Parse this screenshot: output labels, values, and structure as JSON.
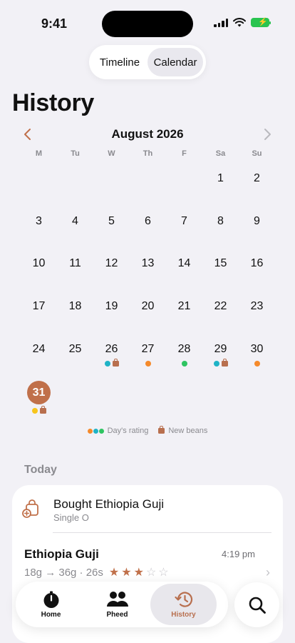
{
  "status": {
    "time": "9:41"
  },
  "segmented": {
    "options": [
      "Timeline",
      "Calendar"
    ],
    "selected": "Calendar"
  },
  "page": {
    "title": "History"
  },
  "calendar": {
    "month": "August 2026",
    "weekdays": [
      "M",
      "Tu",
      "W",
      "Th",
      "F",
      "Sa",
      "Su"
    ],
    "lead_blanks": 5,
    "days": [
      {
        "n": "1"
      },
      {
        "n": "2"
      },
      {
        "n": "3"
      },
      {
        "n": "4"
      },
      {
        "n": "5"
      },
      {
        "n": "6"
      },
      {
        "n": "7"
      },
      {
        "n": "8"
      },
      {
        "n": "9"
      },
      {
        "n": "10"
      },
      {
        "n": "11"
      },
      {
        "n": "12"
      },
      {
        "n": "13"
      },
      {
        "n": "14"
      },
      {
        "n": "15"
      },
      {
        "n": "16"
      },
      {
        "n": "17"
      },
      {
        "n": "18"
      },
      {
        "n": "19"
      },
      {
        "n": "20"
      },
      {
        "n": "21"
      },
      {
        "n": "22"
      },
      {
        "n": "23"
      },
      {
        "n": "24"
      },
      {
        "n": "25"
      },
      {
        "n": "26",
        "dots": [
          "#1fb3c6"
        ],
        "bag": true
      },
      {
        "n": "27",
        "dots": [
          "#f58a2b"
        ]
      },
      {
        "n": "28",
        "dots": [
          "#2ec461"
        ]
      },
      {
        "n": "29",
        "dots": [
          "#1fb3c6"
        ],
        "bag": true
      },
      {
        "n": "30",
        "dots": [
          "#f58a2b"
        ]
      },
      {
        "n": "31",
        "dots": [
          "#f7c51c"
        ],
        "bag": true,
        "today": true
      }
    ],
    "accent": "#c0704a"
  },
  "legend": {
    "rating_label": "Day's rating",
    "rating_colors": [
      "#f58a2b",
      "#1fb3c6",
      "#2ec461"
    ],
    "beans_label": "New beans"
  },
  "today": {
    "section_title": "Today",
    "purchase": {
      "title": "Bought Ethiopia Guji",
      "subtitle": "Single O"
    },
    "brew": {
      "name": "Ethiopia Guji",
      "time": "4:19 pm",
      "detail": "18g → 36g · 26s",
      "rating": 3,
      "max_rating": 5
    }
  },
  "tabbar": {
    "home_label": "Home",
    "pheed_label": "Pheed",
    "history_label": "History",
    "active": "History"
  }
}
